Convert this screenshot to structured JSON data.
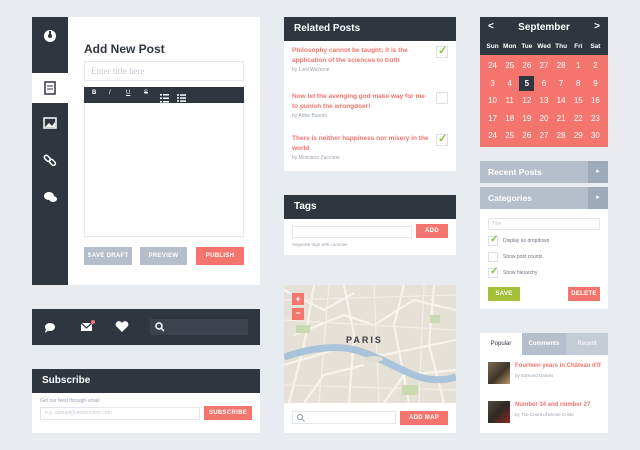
{
  "editor": {
    "title": "Add New Post",
    "title_placeholder": "Enter title here",
    "toolbar": [
      "B",
      "I",
      "U",
      "S"
    ],
    "save_draft": "SAVE DRAFT",
    "preview": "PREVIEW",
    "publish": "PUBLISH"
  },
  "related": {
    "header": "Related Posts",
    "items": [
      {
        "title": "Philosophy cannot be taught; it is the application of the sciences to truth",
        "author": "by Lord Wichone",
        "checked": true
      },
      {
        "title": "Now let the avenging god make way for me to punish the wrongdoer!",
        "author": "by Abbe Busoni",
        "checked": false
      },
      {
        "title": "There is neither happiness nor misery in the world",
        "author": "by Monsieur Zaccone",
        "checked": true
      }
    ]
  },
  "calendar": {
    "month": "September",
    "days": [
      "Sun",
      "Mon",
      "Tue",
      "Wed",
      "Thu",
      "Fri",
      "Sat"
    ],
    "weeks": [
      [
        "24",
        "25",
        "26",
        "27",
        "28",
        "1",
        "2"
      ],
      [
        "3",
        "4",
        "5",
        "6",
        "7",
        "8",
        "9"
      ],
      [
        "10",
        "11",
        "12",
        "13",
        "14",
        "15",
        "16"
      ],
      [
        "17",
        "18",
        "19",
        "20",
        "21",
        "22",
        "23"
      ],
      [
        "24",
        "25",
        "26",
        "27",
        "28",
        "29",
        "30"
      ]
    ],
    "today": "5"
  },
  "tags": {
    "header": "Tags",
    "add": "ADD",
    "hint": "Separate tags with commas"
  },
  "sidebar_widgets": {
    "recent_posts": "Recent Posts",
    "categories": "Categories",
    "cat_placeholder": "Title",
    "options": [
      {
        "label": "Display as dropdown",
        "checked": true
      },
      {
        "label": "Show post counts",
        "checked": false
      },
      {
        "label": "Show hierarchy",
        "checked": true
      }
    ],
    "save": "SAVE",
    "delete": "DELETE"
  },
  "map": {
    "city": "PARIS",
    "zoom_in": "+",
    "zoom_out": "−",
    "add_map": "ADD MAP"
  },
  "subscribe": {
    "header": "Subscribe",
    "hint": "Get our feed through email.",
    "placeholder": "e.g. abmad@ummxcrimo.com",
    "button": "SUBSCRIBE"
  },
  "popular": {
    "tabs": [
      "Popular",
      "Comments",
      "Recent"
    ],
    "items": [
      {
        "title": "Fourteen years in Château d'If",
        "author": "by Edmond Dantès"
      },
      {
        "title": "Number 34 and number 27",
        "author": "by The Count of Monte Cristo"
      }
    ]
  },
  "colors": {
    "dark": "#2f3640",
    "accent": "#f4756e",
    "green": "#8cbf3f",
    "slate": "#b4bfcb"
  }
}
